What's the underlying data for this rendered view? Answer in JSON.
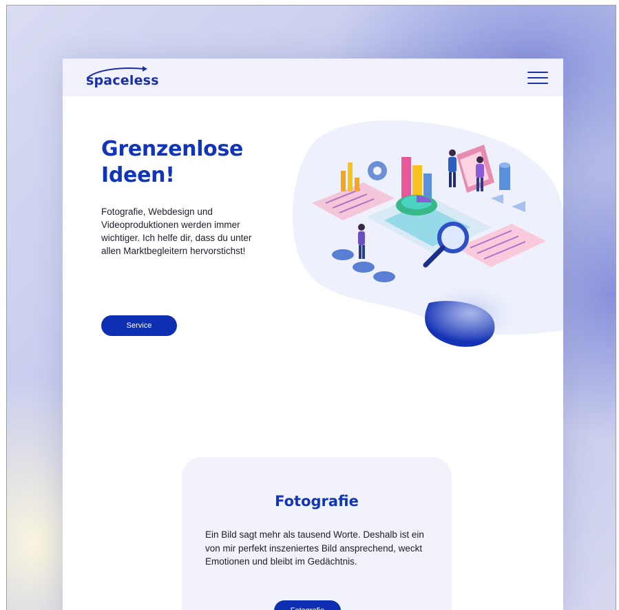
{
  "brand": {
    "logo_text": "spaceless",
    "accent_color": "#1135b8"
  },
  "navbar": {
    "menu_icon": "hamburger-menu-icon"
  },
  "hero": {
    "title": "Grenzenlose\nIdeen!",
    "description": "Fotografie, Webdesign und Videoproduktionen werden immer wichtiger. Ich helfe dir, dass du unter allen Marktbegleitern hervorstichst!",
    "button_label": "Service",
    "illustration": "isometric-data-analytics-illustration"
  },
  "card": {
    "title": "Fotografie",
    "description": "Ein Bild sagt mehr als tausend Worte. Deshalb ist ein von mir perfekt inszeniertes Bild ansprechend, weckt Emotionen und bleibt im Gedächtnis.",
    "button_label": "Fotografie"
  }
}
